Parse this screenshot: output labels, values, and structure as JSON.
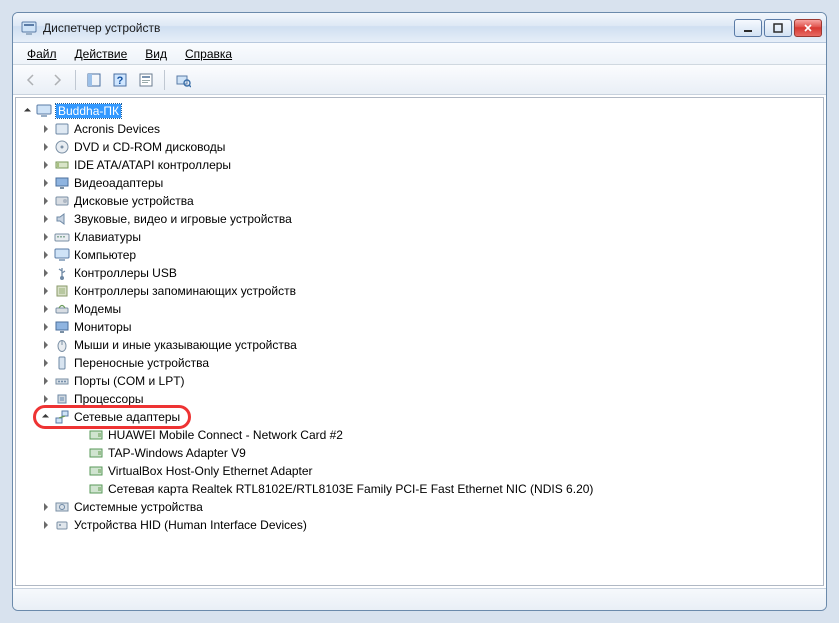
{
  "window": {
    "title": "Диспетчер устройств"
  },
  "menu": {
    "file": "Файл",
    "action": "Действие",
    "view": "Вид",
    "help": "Справка"
  },
  "tree": {
    "root": "Buddha-ПК",
    "items": [
      "Acronis Devices",
      "DVD и CD-ROM дисководы",
      "IDE ATA/ATAPI контроллеры",
      "Видеоадаптеры",
      "Дисковые устройства",
      "Звуковые, видео и игровые устройства",
      "Клавиатуры",
      "Компьютер",
      "Контроллеры USB",
      "Контроллеры запоминающих устройств",
      "Модемы",
      "Мониторы",
      "Мыши и иные указывающие устройства",
      "Переносные устройства",
      "Порты (COM и LPT)",
      "Процессоры",
      "Сетевые адаптеры",
      "Системные устройства",
      "Устройства HID (Human Interface Devices)"
    ],
    "network_children": [
      "HUAWEI Mobile Connect - Network Card #2",
      "TAP-Windows Adapter V9",
      "VirtualBox Host-Only Ethernet Adapter",
      "Сетевая карта Realtek RTL8102E/RTL8103E Family PCI-E Fast Ethernet NIC (NDIS 6.20)"
    ]
  },
  "highlight_index": 16
}
